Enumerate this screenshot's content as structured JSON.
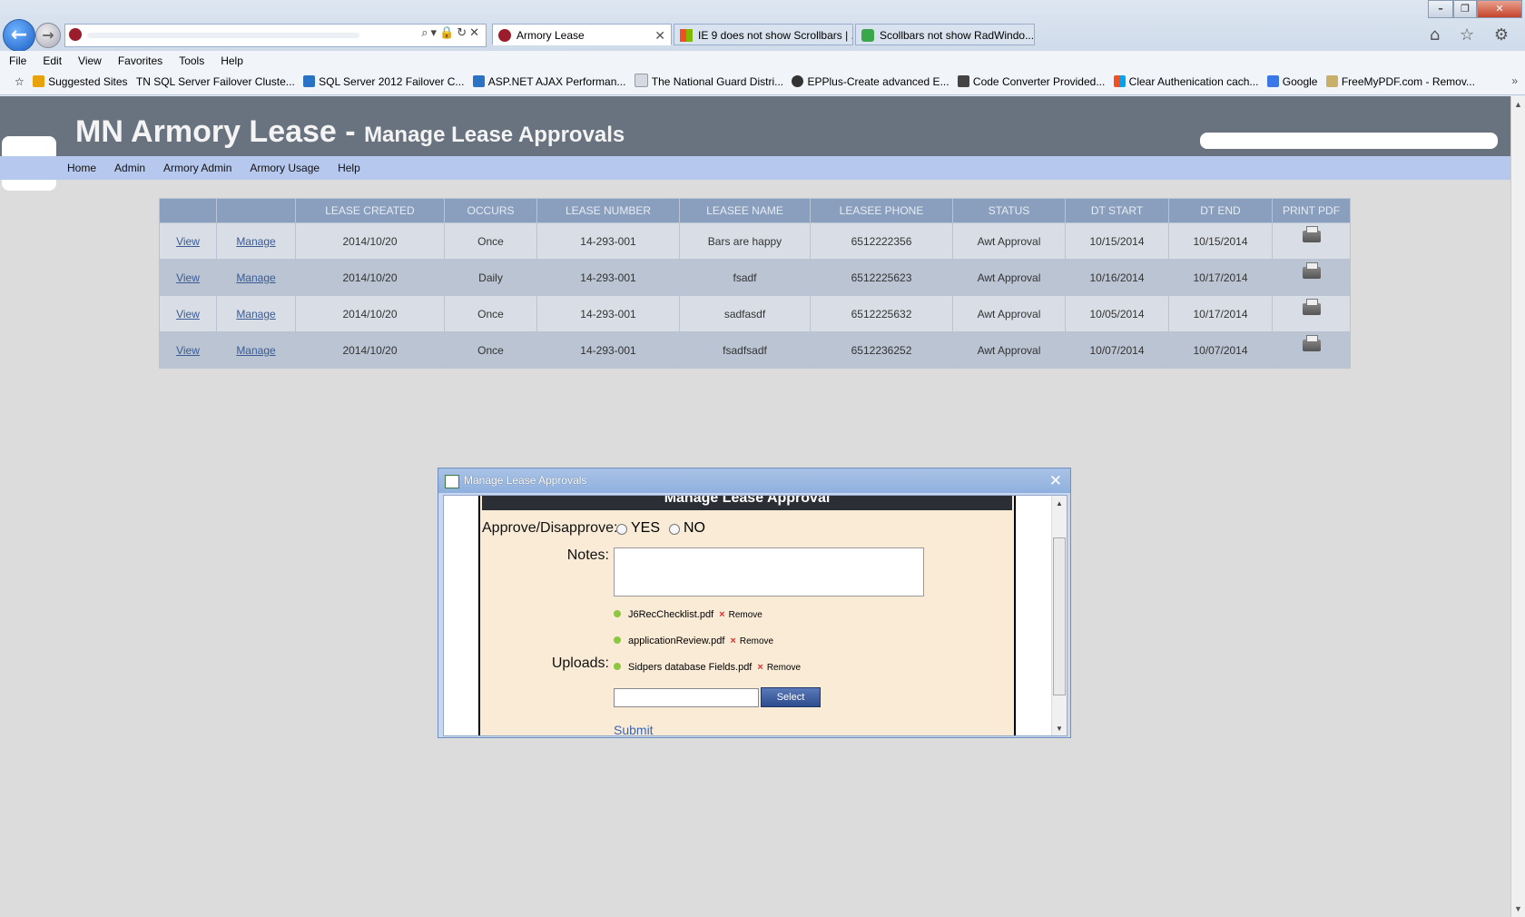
{
  "browser": {
    "address_visible_text": "",
    "tabs": [
      {
        "label": "Armory Lease",
        "active": true,
        "icon": "armory-favicon"
      },
      {
        "label": "IE 9 does not show Scrollbars | ...",
        "active": false,
        "icon": "windows-favicon"
      },
      {
        "label": "Scollbars not show RadWindo...",
        "active": false,
        "icon": "telerik-favicon"
      }
    ],
    "window_controls": {
      "minimize": "–",
      "restore": "❐",
      "close": "✕"
    },
    "right_tools": "⌂ ☆ ⚙"
  },
  "menu": [
    "File",
    "Edit",
    "View",
    "Favorites",
    "Tools",
    "Help"
  ],
  "favorites": [
    {
      "label": "Suggested Sites",
      "color": "#e8a20c"
    },
    {
      "label": "TN SQL Server Failover Cluste...",
      "color": ""
    },
    {
      "label": "SQL Server 2012 Failover C...",
      "color": "#2a72c4"
    },
    {
      "label": "ASP.NET AJAX Performan...",
      "color": "#2a72c4"
    },
    {
      "label": "The National Guard Distri...",
      "color": "#d4d9e2"
    },
    {
      "label": "EPPlus-Create advanced E...",
      "color": "#333"
    },
    {
      "label": "Code Converter  Provided...",
      "color": "#444"
    },
    {
      "label": "Clear Authenication cach...",
      "color": "#e04a1f"
    },
    {
      "label": "Google",
      "color": "#3b78e7"
    },
    {
      "label": "FreeMyPDF.com - Remov...",
      "color": "#c9b06a"
    }
  ],
  "header": {
    "title": "MN Armory Lease - ",
    "subtitle": "Manage Lease Approvals"
  },
  "nav": [
    "Home",
    "Admin",
    "Armory Admin",
    "Armory Usage",
    "Help"
  ],
  "table": {
    "columns": [
      "",
      "",
      "Lease Created",
      "Occurs",
      "Lease Number",
      "Leasee Name",
      "Leasee Phone",
      "Status",
      "DT Start",
      "DT End",
      "Print PDF"
    ],
    "rows": [
      {
        "view": "View",
        "manage": "Manage",
        "created": "2014/10/20",
        "occurs": "Once",
        "number": "14-293-001",
        "name": "Bars are happy",
        "phone": "6512222356",
        "status": "Awt Approval",
        "start": "10/15/2014",
        "end": "10/15/2014"
      },
      {
        "view": "View",
        "manage": "Manage",
        "created": "2014/10/20",
        "occurs": "Daily",
        "number": "14-293-001",
        "name": "fsadf",
        "phone": "6512225623",
        "status": "Awt Approval",
        "start": "10/16/2014",
        "end": "10/17/2014"
      },
      {
        "view": "View",
        "manage": "Manage",
        "created": "2014/10/20",
        "occurs": "Once",
        "number": "14-293-001",
        "name": "sadfasdf",
        "phone": "6512225632",
        "status": "Awt Approval",
        "start": "10/05/2014",
        "end": "10/17/2014"
      },
      {
        "view": "View",
        "manage": "Manage",
        "created": "2014/10/20",
        "occurs": "Once",
        "number": "14-293-001",
        "name": "fsadfsadf",
        "phone": "6512236252",
        "status": "Awt Approval",
        "start": "10/07/2014",
        "end": "10/07/2014"
      }
    ]
  },
  "dialog": {
    "title": "Manage Lease Approvals",
    "close": "✕",
    "panel_heading": "Manage Lease Approval",
    "approve_label": "Approve/Disapprove:",
    "yes_label": "YES",
    "no_label": "NO",
    "notes_label": "Notes:",
    "notes_value": "",
    "uploads_label": "Uploads:",
    "files": [
      "J6RecChecklist.pdf",
      "applicationReview.pdf",
      "Sidpers database Fields.pdf"
    ],
    "remove_label": "Remove",
    "remove_glyph": "×",
    "select_label": "Select",
    "submit_label": "Submit"
  }
}
